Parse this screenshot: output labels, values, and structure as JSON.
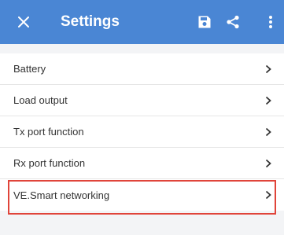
{
  "toolbar": {
    "title": "Settings",
    "close_icon": "close-icon",
    "save_icon": "save-icon",
    "share_icon": "share-icon",
    "more_icon": "more-vert-icon",
    "background_color": "#4a86d4"
  },
  "settings_list": {
    "items": [
      {
        "label": "Battery",
        "icon": "chevron-right-icon"
      },
      {
        "label": "Load output",
        "icon": "chevron-right-icon"
      },
      {
        "label": "Tx port function",
        "icon": "chevron-right-icon"
      },
      {
        "label": "Rx port function",
        "icon": "chevron-right-icon",
        "highlighted": true
      },
      {
        "label": "VE.Smart networking",
        "icon": "chevron-right-icon"
      }
    ]
  },
  "highlight_color": "#e0443a"
}
